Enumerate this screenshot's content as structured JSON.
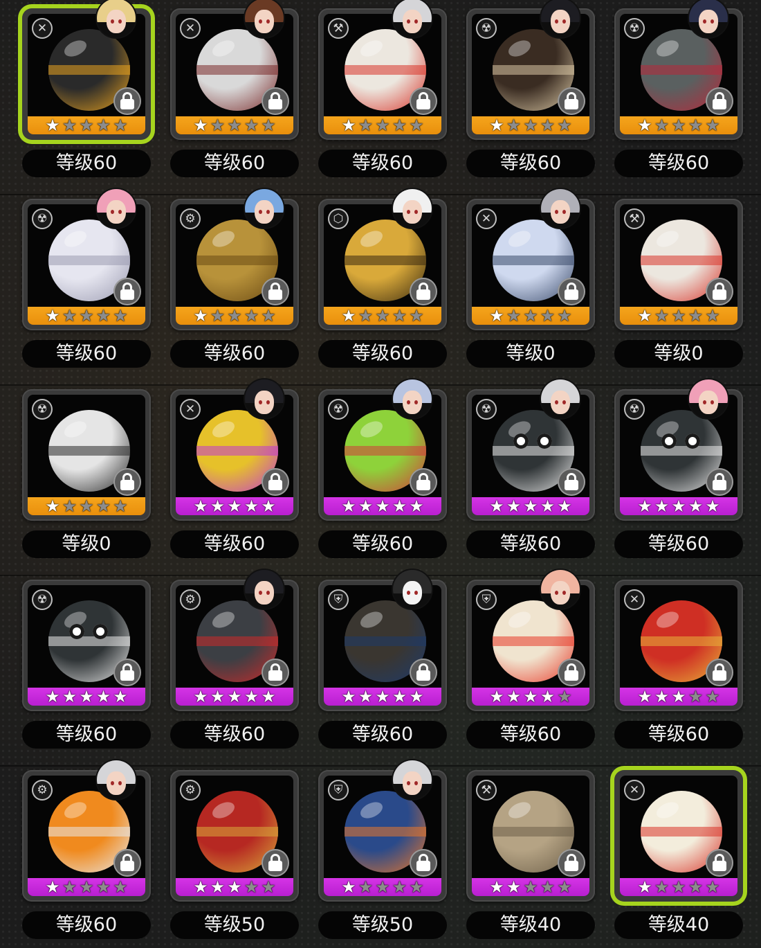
{
  "colors": {
    "selected_border": "#a6d41e",
    "stars_orange": "#f5a51c",
    "stars_purple": "#c92ad9",
    "star_on": "#ffffff",
    "star_off": "#8c8c8c"
  },
  "items": [
    {
      "level": "等级60",
      "stars": 1,
      "rarity": "orange",
      "type_icon": "crossed-tools-icon",
      "avatar": "blonde",
      "art": "black-orange-ball",
      "selected": true
    },
    {
      "level": "等级60",
      "stars": 1,
      "rarity": "orange",
      "type_icon": "crossed-tools-icon",
      "avatar": "brown",
      "art": "glass-orb",
      "selected": false
    },
    {
      "level": "等级60",
      "stars": 1,
      "rarity": "orange",
      "type_icon": "hammer-icon",
      "avatar": "silver",
      "art": "white-red-ball",
      "selected": false
    },
    {
      "level": "等级60",
      "stars": 1,
      "rarity": "orange",
      "type_icon": "radiation-icon",
      "avatar": "black",
      "art": "house-ball",
      "selected": false
    },
    {
      "level": "等级60",
      "stars": 1,
      "rarity": "orange",
      "type_icon": "radiation-icon",
      "avatar": "navy",
      "art": "spiked-gray-ball",
      "selected": false
    },
    {
      "level": "等级60",
      "stars": 1,
      "rarity": "orange",
      "type_icon": "radiation-icon",
      "avatar": "pink",
      "art": "white-feather-ball",
      "selected": false
    },
    {
      "level": "等级60",
      "stars": 1,
      "rarity": "orange",
      "type_icon": "wrench-icon",
      "avatar": "blue",
      "art": "golden-ball",
      "selected": false
    },
    {
      "level": "等级60",
      "stars": 1,
      "rarity": "orange",
      "type_icon": "hexagon-icon",
      "avatar": "white",
      "art": "birdcage-ball",
      "selected": false
    },
    {
      "level": "等级0",
      "stars": 1,
      "rarity": "orange",
      "type_icon": "crossed-tools-icon",
      "avatar": "gray",
      "art": "crystal-ball",
      "selected": false
    },
    {
      "level": "等级0",
      "stars": 1,
      "rarity": "orange",
      "type_icon": "hammer-icon",
      "avatar": "none",
      "art": "white-red-ball",
      "selected": false
    },
    {
      "level": "等级0",
      "stars": 1,
      "rarity": "orange",
      "type_icon": "radiation-icon",
      "avatar": "none",
      "art": "white-black-ball",
      "selected": false
    },
    {
      "level": "等级60",
      "stars": 5,
      "rarity": "purple",
      "type_icon": "crossed-tools-icon",
      "avatar": "black",
      "art": "flower-gold-ball",
      "selected": false
    },
    {
      "level": "等级60",
      "stars": 5,
      "rarity": "purple",
      "type_icon": "radiation-icon",
      "avatar": "silver-blue",
      "art": "green-monster-ball",
      "selected": false
    },
    {
      "level": "等级60",
      "stars": 5,
      "rarity": "purple",
      "type_icon": "radiation-icon",
      "avatar": "silver",
      "art": "goggle-ball",
      "selected": false
    },
    {
      "level": "等级60",
      "stars": 5,
      "rarity": "purple",
      "type_icon": "radiation-icon",
      "avatar": "pink",
      "art": "goggle-ball",
      "selected": false
    },
    {
      "level": "等级60",
      "stars": 5,
      "rarity": "purple",
      "type_icon": "radiation-icon",
      "avatar": "none",
      "art": "goggle-ball",
      "selected": false
    },
    {
      "level": "等级60",
      "stars": 5,
      "rarity": "purple",
      "type_icon": "wrench-icon",
      "avatar": "black",
      "art": "robot-gorilla-ball",
      "selected": false
    },
    {
      "level": "等级60",
      "stars": 5,
      "rarity": "purple",
      "type_icon": "shield-icon",
      "avatar": "panda",
      "art": "armored-dark-ball",
      "selected": false
    },
    {
      "level": "等级60",
      "stars": 4,
      "rarity": "purple",
      "type_icon": "shield-icon",
      "avatar": "peach",
      "art": "star-emblem-ball",
      "selected": false
    },
    {
      "level": "等级60",
      "stars": 3,
      "rarity": "purple",
      "type_icon": "crossed-tools-icon",
      "avatar": "none",
      "art": "red-helmet-ball",
      "selected": false
    },
    {
      "level": "等级60",
      "stars": 1,
      "rarity": "purple",
      "type_icon": "wrench-icon",
      "avatar": "silver",
      "art": "camera-ball",
      "selected": false
    },
    {
      "level": "等级50",
      "stars": 3,
      "rarity": "purple",
      "type_icon": "wrench-icon",
      "avatar": "none",
      "art": "red-armor-ball",
      "selected": false
    },
    {
      "level": "等级50",
      "stars": 1,
      "rarity": "purple",
      "type_icon": "shield-icon",
      "avatar": "silver",
      "art": "blue-armor-ball",
      "selected": false
    },
    {
      "level": "等级40",
      "stars": 2,
      "rarity": "purple",
      "type_icon": "hammer-icon",
      "avatar": "none",
      "art": "fossil-ball",
      "selected": false
    },
    {
      "level": "等级40",
      "stars": 1,
      "rarity": "purple",
      "type_icon": "crossed-tools-icon",
      "avatar": "none",
      "art": "lucky-cat-ball",
      "selected": true
    }
  ]
}
